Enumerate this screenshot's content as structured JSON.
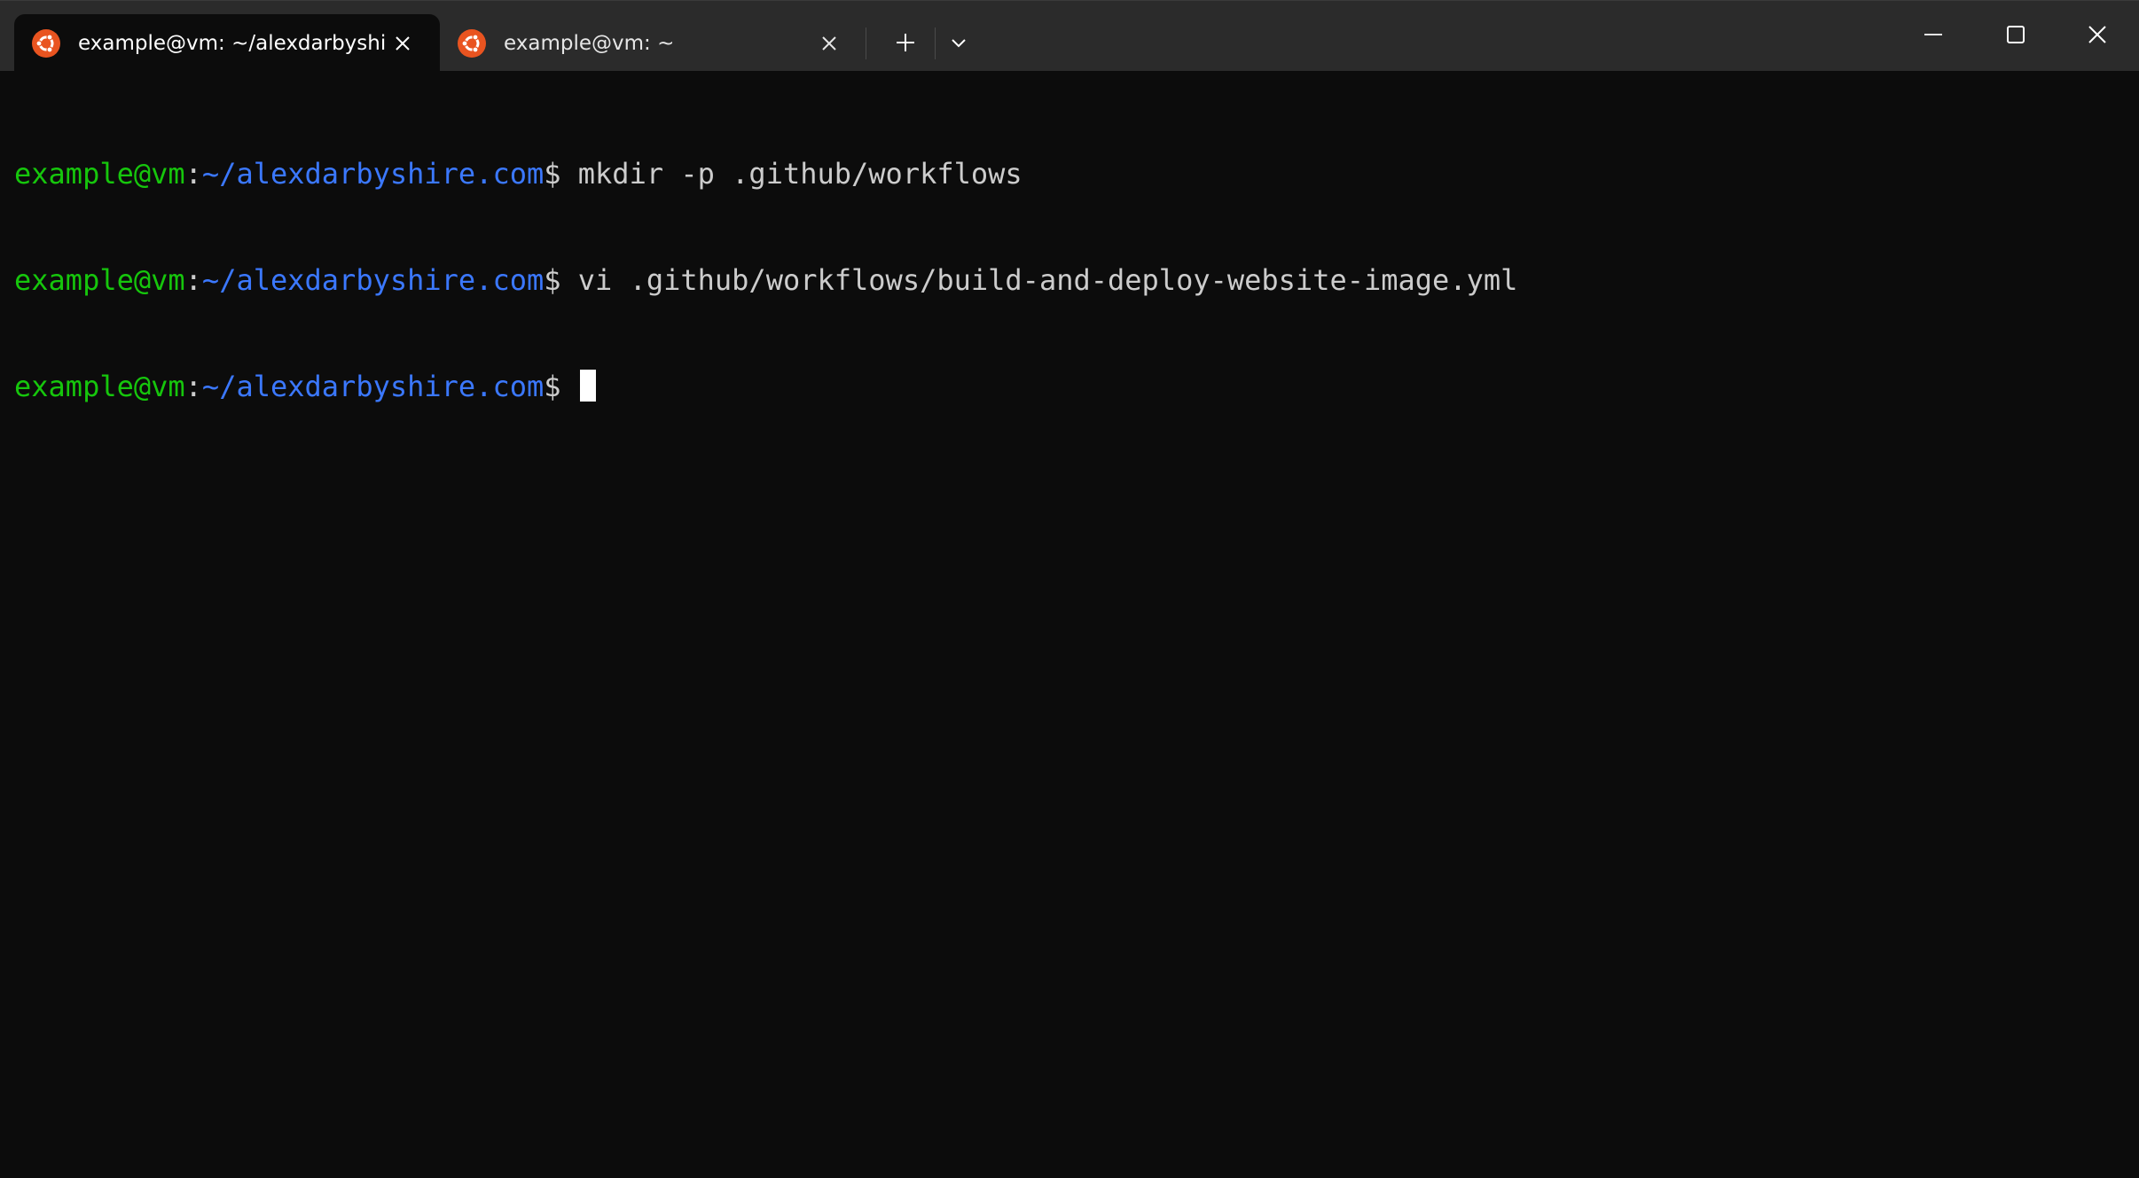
{
  "window": {
    "tabs": [
      {
        "title": "example@vm: ~/alexdarbyshi",
        "active": true,
        "icon": "ubuntu-icon"
      },
      {
        "title": "example@vm: ~",
        "active": false,
        "icon": "ubuntu-icon"
      }
    ],
    "controls": [
      "new-tab-icon",
      "chevron-down-icon",
      "minimize-icon",
      "maximize-icon",
      "close-icon"
    ]
  },
  "terminal": {
    "lines": [
      {
        "user": "example@vm",
        "sep": ":",
        "path": "~/alexdarbyshire.com",
        "prompt": "$ ",
        "command": "mkdir -p .github/workflows"
      },
      {
        "user": "example@vm",
        "sep": ":",
        "path": "~/alexdarbyshire.com",
        "prompt": "$ ",
        "command": "vi .github/workflows/build-and-deploy-website-image.yml"
      },
      {
        "user": "example@vm",
        "sep": ":",
        "path": "~/alexdarbyshire.com",
        "prompt": "$ ",
        "command": ""
      }
    ]
  },
  "colors": {
    "background": "#0c0c0c",
    "titlebar": "#2b2b2b",
    "user": "#16c60c",
    "path": "#3b78ff",
    "text": "#cccccc",
    "ubuntu": "#e95420"
  }
}
